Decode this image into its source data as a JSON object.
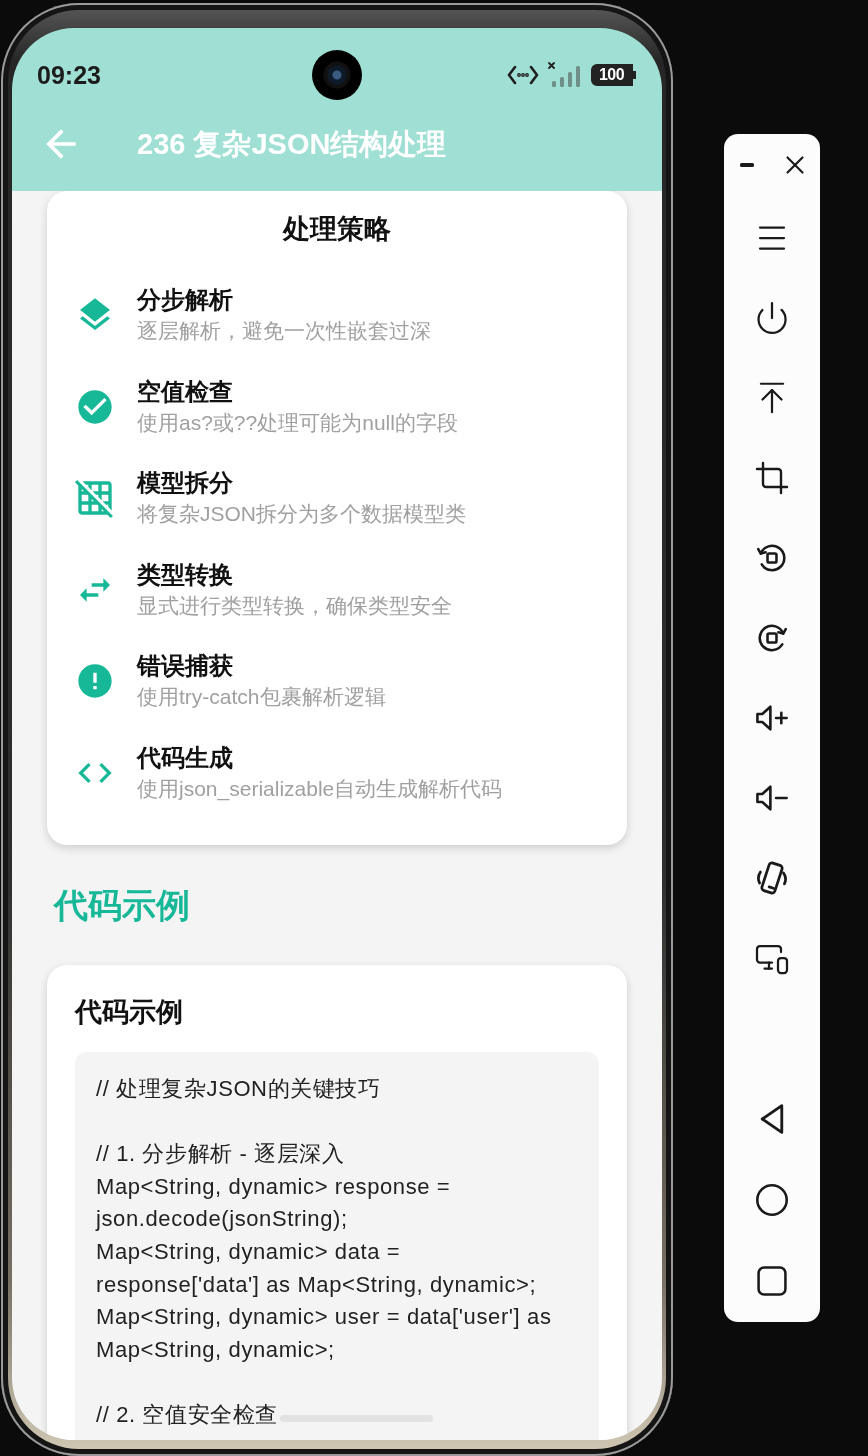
{
  "status_bar": {
    "time": "09:23",
    "battery": "100"
  },
  "app_bar": {
    "title": "236 复杂JSON结构处理"
  },
  "strategy_card": {
    "title": "处理策略",
    "items": [
      {
        "kind": "layers",
        "title": "分步解析",
        "description": "逐层解析，避免一次性嵌套过深"
      },
      {
        "kind": "check",
        "title": "空值检查",
        "description": "使用as?或??处理可能为null的字段"
      },
      {
        "kind": "grid-off",
        "title": "模型拆分",
        "description": "将复杂JSON拆分为多个数据模型类"
      },
      {
        "kind": "swap",
        "title": "类型转换",
        "description": "显式进行类型转换，确保类型安全"
      },
      {
        "kind": "alert",
        "title": "错误捕获",
        "description": "使用try-catch包裹解析逻辑"
      },
      {
        "kind": "code",
        "title": "代码生成",
        "description": "使用json_serializable自动生成解析代码"
      }
    ]
  },
  "section_heading": "代码示例",
  "code_card": {
    "title": "代码示例",
    "code": "// 处理复杂JSON的关键技巧\n\n// 1. 分步解析 - 逐层深入\nMap<String, dynamic> response =\njson.decode(jsonString);\nMap<String, dynamic> data =\nresponse['data'] as Map<String, dynamic>;\nMap<String, dynamic> user = data['user'] as\nMap<String, dynamic>;\n\n// 2. 空值安全检查"
  },
  "toolbar": {
    "window_buttons": [
      {
        "kind": "minimize"
      },
      {
        "kind": "close"
      }
    ],
    "tools": [
      {
        "kind": "menu"
      },
      {
        "kind": "power"
      },
      {
        "kind": "pin-top"
      },
      {
        "kind": "crop"
      },
      {
        "kind": "rotate-left"
      },
      {
        "kind": "rotate-right"
      },
      {
        "kind": "volume-up"
      },
      {
        "kind": "volume-down"
      },
      {
        "kind": "shake"
      },
      {
        "kind": "devices"
      }
    ],
    "navigation": [
      {
        "kind": "back"
      },
      {
        "kind": "home"
      },
      {
        "kind": "recents"
      }
    ]
  }
}
